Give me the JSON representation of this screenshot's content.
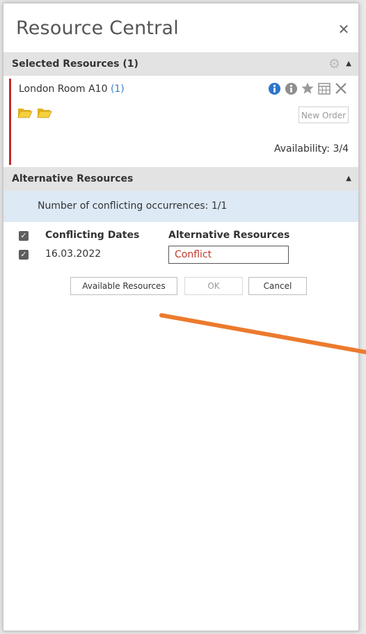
{
  "panel": {
    "title": "Resource Central",
    "close_icon": "close-icon"
  },
  "selected_resources": {
    "header": "Selected Resources (1)",
    "resource": {
      "name": "London Room A10",
      "count": "(1)",
      "icons": [
        "info-icon",
        "info-outline-icon",
        "star-icon",
        "calendar-icon",
        "remove-icon"
      ],
      "folders": [
        "folder-icon",
        "folder-icon"
      ],
      "new_order_label": "New Order",
      "availability": "Availability: 3/4",
      "accent_color": "#c62828"
    }
  },
  "alternative_resources": {
    "header": "Alternative Resources",
    "conflict_note": "Number of conflicting occurrences: 1/1",
    "columns": {
      "conflicting_dates": "Conflicting Dates",
      "alternative_resources": "Alternative Resources"
    },
    "rows": [
      {
        "date": "16.03.2022",
        "alternative": "Conflict",
        "checked": true
      }
    ],
    "buttons": {
      "available_resources": "Available Resources",
      "ok": "OK",
      "cancel": "Cancel"
    }
  },
  "colors": {
    "header_bg": "#e3e3e3",
    "note_bg": "#dde9f4",
    "conflict_text": "#c0392b",
    "arrow": "#ec7a2d"
  }
}
